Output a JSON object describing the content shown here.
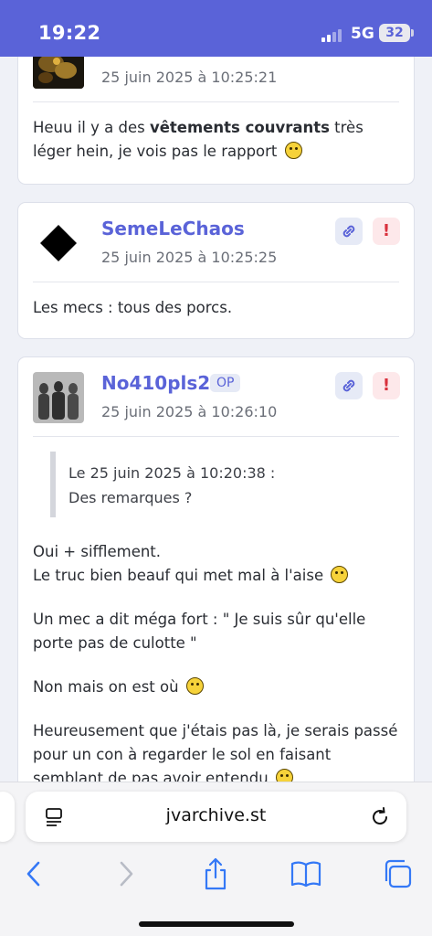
{
  "status_bar": {
    "time": "19:22",
    "network": "5G",
    "battery": "32"
  },
  "posts": [
    {
      "author": "",
      "date": "25 juin 2025 à 10:25:21",
      "message_parts": [
        "Heuu il y a des ",
        "vêtements couvrants",
        " très léger hein, je vois pas le rapport"
      ]
    },
    {
      "author": "SemeLeChaos",
      "date": "25 juin 2025 à 10:25:25",
      "message": "Les mecs : tous des porcs."
    },
    {
      "author": "No410pls2",
      "badge": "OP",
      "date": "25 juin 2025 à 10:26:10",
      "quote": {
        "header": "Le 25 juin 2025 à 10:20:38 :",
        "text": "Des remarques ?"
      },
      "paragraphs": [
        {
          "line1": "Oui + sifflement.",
          "line2": "Le truc bien beauf qui met mal à l'aise"
        },
        {
          "line1": "Un mec a dit méga fort : \" Je suis sûr qu'elle",
          "line2": "porte pas de culotte \""
        },
        {
          "line1": "Non mais on est où"
        },
        {
          "line1": "Heureusement que j'étais pas là, je serais passé",
          "line2": "pour un con à regarder le sol en faisant",
          "line3": "semblant de pas avoir entendu"
        }
      ]
    }
  ],
  "browser": {
    "url": "jvarchive.st"
  },
  "icons": [
    "link-icon",
    "report-icon",
    "reader-icon",
    "reload-icon",
    "back-icon",
    "forward-icon",
    "share-icon",
    "bookmarks-icon",
    "tabs-icon"
  ],
  "colors": {
    "accent": "#5a63d8",
    "report": "#d9313d",
    "background": "#eff1f7"
  }
}
